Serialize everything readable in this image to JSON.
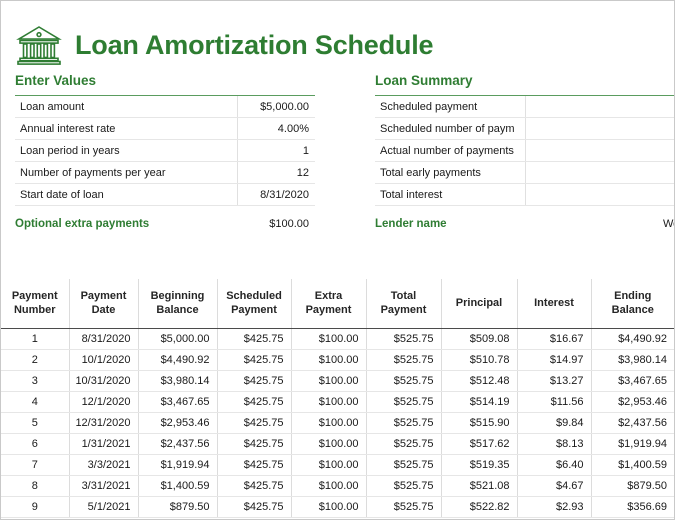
{
  "document": {
    "title": "Loan Amortization Schedule",
    "icon": "bank-icon",
    "title_color": "#2e7d32",
    "accent_color": "#2f7d33",
    "rule_color": "#5a9c5e"
  },
  "enter_values": {
    "heading": "Enter Values",
    "rows": [
      {
        "label": "Loan amount",
        "value": "$5,000.00"
      },
      {
        "label": "Annual interest rate",
        "value": "4.00%"
      },
      {
        "label": "Loan period in years",
        "value": "1"
      },
      {
        "label": "Number of payments per year",
        "value": "12"
      },
      {
        "label": "Start date of loan",
        "value": "8/31/2020"
      }
    ],
    "extra": {
      "label": "Optional extra payments",
      "value": "$100.00"
    }
  },
  "loan_summary": {
    "heading": "Loan Summary",
    "rows": [
      {
        "label": "Scheduled payment",
        "value": ""
      },
      {
        "label": "Scheduled number of paym",
        "value": ""
      },
      {
        "label": "Actual number of payments",
        "value": ""
      },
      {
        "label": "Total early payments",
        "value": ""
      },
      {
        "label": "Total interest",
        "value": ""
      }
    ],
    "lender": {
      "label": "Lender name",
      "value": "Wo"
    }
  },
  "schedule": {
    "columns": [
      "Payment\nNumber",
      "Payment\nDate",
      "Beginning\nBalance",
      "Scheduled\nPayment",
      "Extra\nPayment",
      "Total\nPayment",
      "Principal",
      "Interest",
      "Ending\nBalance"
    ],
    "rows": [
      [
        "1",
        "8/31/2020",
        "$5,000.00",
        "$425.75",
        "$100.00",
        "$525.75",
        "$509.08",
        "$16.67",
        "$4,490.92"
      ],
      [
        "2",
        "10/1/2020",
        "$4,490.92",
        "$425.75",
        "$100.00",
        "$525.75",
        "$510.78",
        "$14.97",
        "$3,980.14"
      ],
      [
        "3",
        "10/31/2020",
        "$3,980.14",
        "$425.75",
        "$100.00",
        "$525.75",
        "$512.48",
        "$13.27",
        "$3,467.65"
      ],
      [
        "4",
        "12/1/2020",
        "$3,467.65",
        "$425.75",
        "$100.00",
        "$525.75",
        "$514.19",
        "$11.56",
        "$2,953.46"
      ],
      [
        "5",
        "12/31/2020",
        "$2,953.46",
        "$425.75",
        "$100.00",
        "$525.75",
        "$515.90",
        "$9.84",
        "$2,437.56"
      ],
      [
        "6",
        "1/31/2021",
        "$2,437.56",
        "$425.75",
        "$100.00",
        "$525.75",
        "$517.62",
        "$8.13",
        "$1,919.94"
      ],
      [
        "7",
        "3/3/2021",
        "$1,919.94",
        "$425.75",
        "$100.00",
        "$525.75",
        "$519.35",
        "$6.40",
        "$1,400.59"
      ],
      [
        "8",
        "3/31/2021",
        "$1,400.59",
        "$425.75",
        "$100.00",
        "$525.75",
        "$521.08",
        "$4.67",
        "$879.50"
      ],
      [
        "9",
        "5/1/2021",
        "$879.50",
        "$425.75",
        "$100.00",
        "$525.75",
        "$522.82",
        "$2.93",
        "$356.69"
      ]
    ]
  }
}
